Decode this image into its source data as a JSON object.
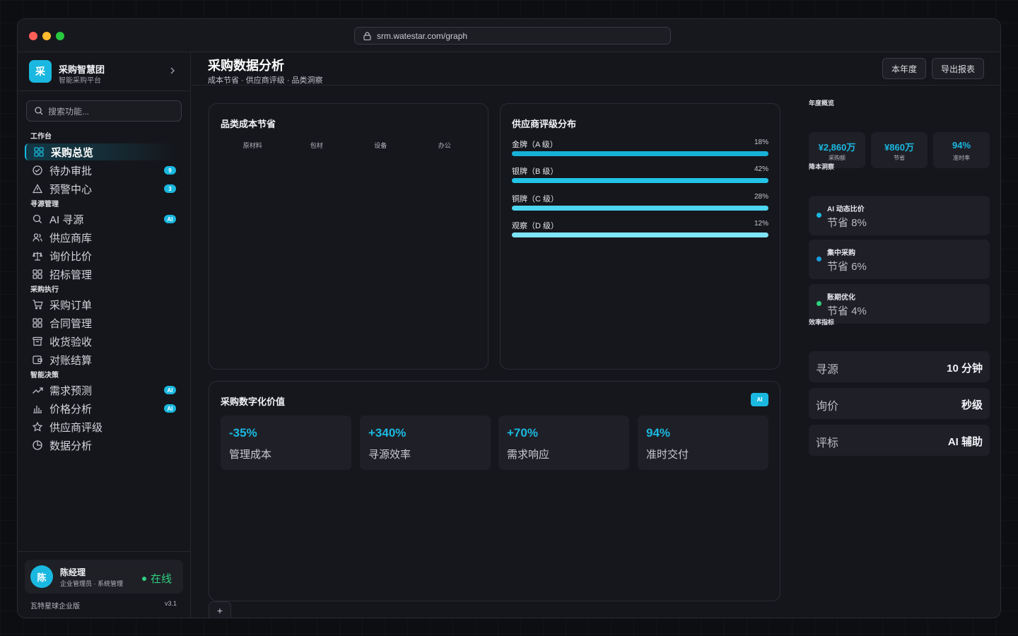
{
  "browser": {
    "url": "srm.watestar.com/graph"
  },
  "org": {
    "logo_char": "采",
    "name": "采购智慧团",
    "subtitle": "智能采购平台"
  },
  "search": {
    "placeholder": "搜索功能..."
  },
  "sidebar": {
    "sections": [
      "工作台",
      "寻源管理",
      "采购执行",
      "智能决策"
    ],
    "items": [
      {
        "label": "采购总览",
        "icon": "grid-icon",
        "active": true
      },
      {
        "label": "待办审批",
        "icon": "check-circle-icon",
        "badge": "9"
      },
      {
        "label": "预警中心",
        "icon": "alert-triangle-icon",
        "badge": "3"
      },
      {
        "label": "AI 寻源",
        "icon": "search-icon",
        "badge": "AI"
      },
      {
        "label": "供应商库",
        "icon": "users-icon"
      },
      {
        "label": "询价比价",
        "icon": "scale-icon"
      },
      {
        "label": "招标管理",
        "icon": "grid-icon"
      },
      {
        "label": "采购订单",
        "icon": "cart-icon"
      },
      {
        "label": "合同管理",
        "icon": "grid-icon"
      },
      {
        "label": "收货验收",
        "icon": "archive-icon"
      },
      {
        "label": "对账结算",
        "icon": "wallet-icon"
      },
      {
        "label": "需求预测",
        "icon": "trend-up-icon",
        "badge": "AI"
      },
      {
        "label": "价格分析",
        "icon": "bar-chart-icon",
        "badge": "AI"
      },
      {
        "label": "供应商评级",
        "icon": "star-icon"
      },
      {
        "label": "数据分析",
        "icon": "pie-icon"
      }
    ]
  },
  "user": {
    "avatar_char": "陈",
    "name": "陈经理",
    "role": "企业管理员 · 系统管理",
    "status": "在线"
  },
  "footer": {
    "edition": "瓦特星球企业版",
    "version": "v3.1"
  },
  "header": {
    "title": "采购数据分析",
    "subtitle": "成本节省 · 供应商评级 · 品类洞察",
    "btn_year": "本年度",
    "btn_export": "导出报表"
  },
  "category_card": {
    "title": "品类成本节省",
    "categories": [
      "原材料",
      "包材",
      "设备",
      "办公"
    ]
  },
  "rating_card": {
    "title": "供应商评级分布",
    "items": [
      {
        "label": "金牌（A 级）",
        "pct": "18%",
        "fill": 1.0,
        "color": "#17b1d8"
      },
      {
        "label": "银牌（B 级）",
        "pct": "42%",
        "fill": 1.0,
        "color": "#22c4e6"
      },
      {
        "label": "铜牌（C 级）",
        "pct": "28%",
        "fill": 1.0,
        "color": "#4dd6f0"
      },
      {
        "label": "观察（D 级）",
        "pct": "12%",
        "fill": 1.0,
        "color": "#7fe4f7"
      }
    ]
  },
  "value_card": {
    "title": "采购数字化价值",
    "tag": "AI",
    "stats": [
      {
        "value": "-35%",
        "label": "管理成本"
      },
      {
        "value": "+340%",
        "label": "寻源效率"
      },
      {
        "value": "+70%",
        "label": "需求响应"
      },
      {
        "value": "94%",
        "label": "准时交付"
      }
    ]
  },
  "right_panel": {
    "overview_label": "年度概览",
    "overview": [
      {
        "value": "¥2,860万",
        "label": "采购额"
      },
      {
        "value": "¥860万",
        "label": "节省"
      },
      {
        "value": "94%",
        "label": "准时率"
      }
    ],
    "insights_label": "降本洞察",
    "insights": [
      {
        "title": "AI 动态比价",
        "value": "节省 8%",
        "color": "#1ab8e0"
      },
      {
        "title": "集中采购",
        "value": "节省 6%",
        "color": "#1a9de0"
      },
      {
        "title": "账期优化",
        "value": "节省 4%",
        "color": "#2fd080"
      }
    ],
    "metrics_label": "效率指标",
    "metrics": [
      {
        "label": "寻源",
        "value": "10 分钟"
      },
      {
        "label": "询价",
        "value": "秒级"
      },
      {
        "label": "评标",
        "value": "AI 辅助"
      }
    ]
  },
  "add_tab": "+"
}
